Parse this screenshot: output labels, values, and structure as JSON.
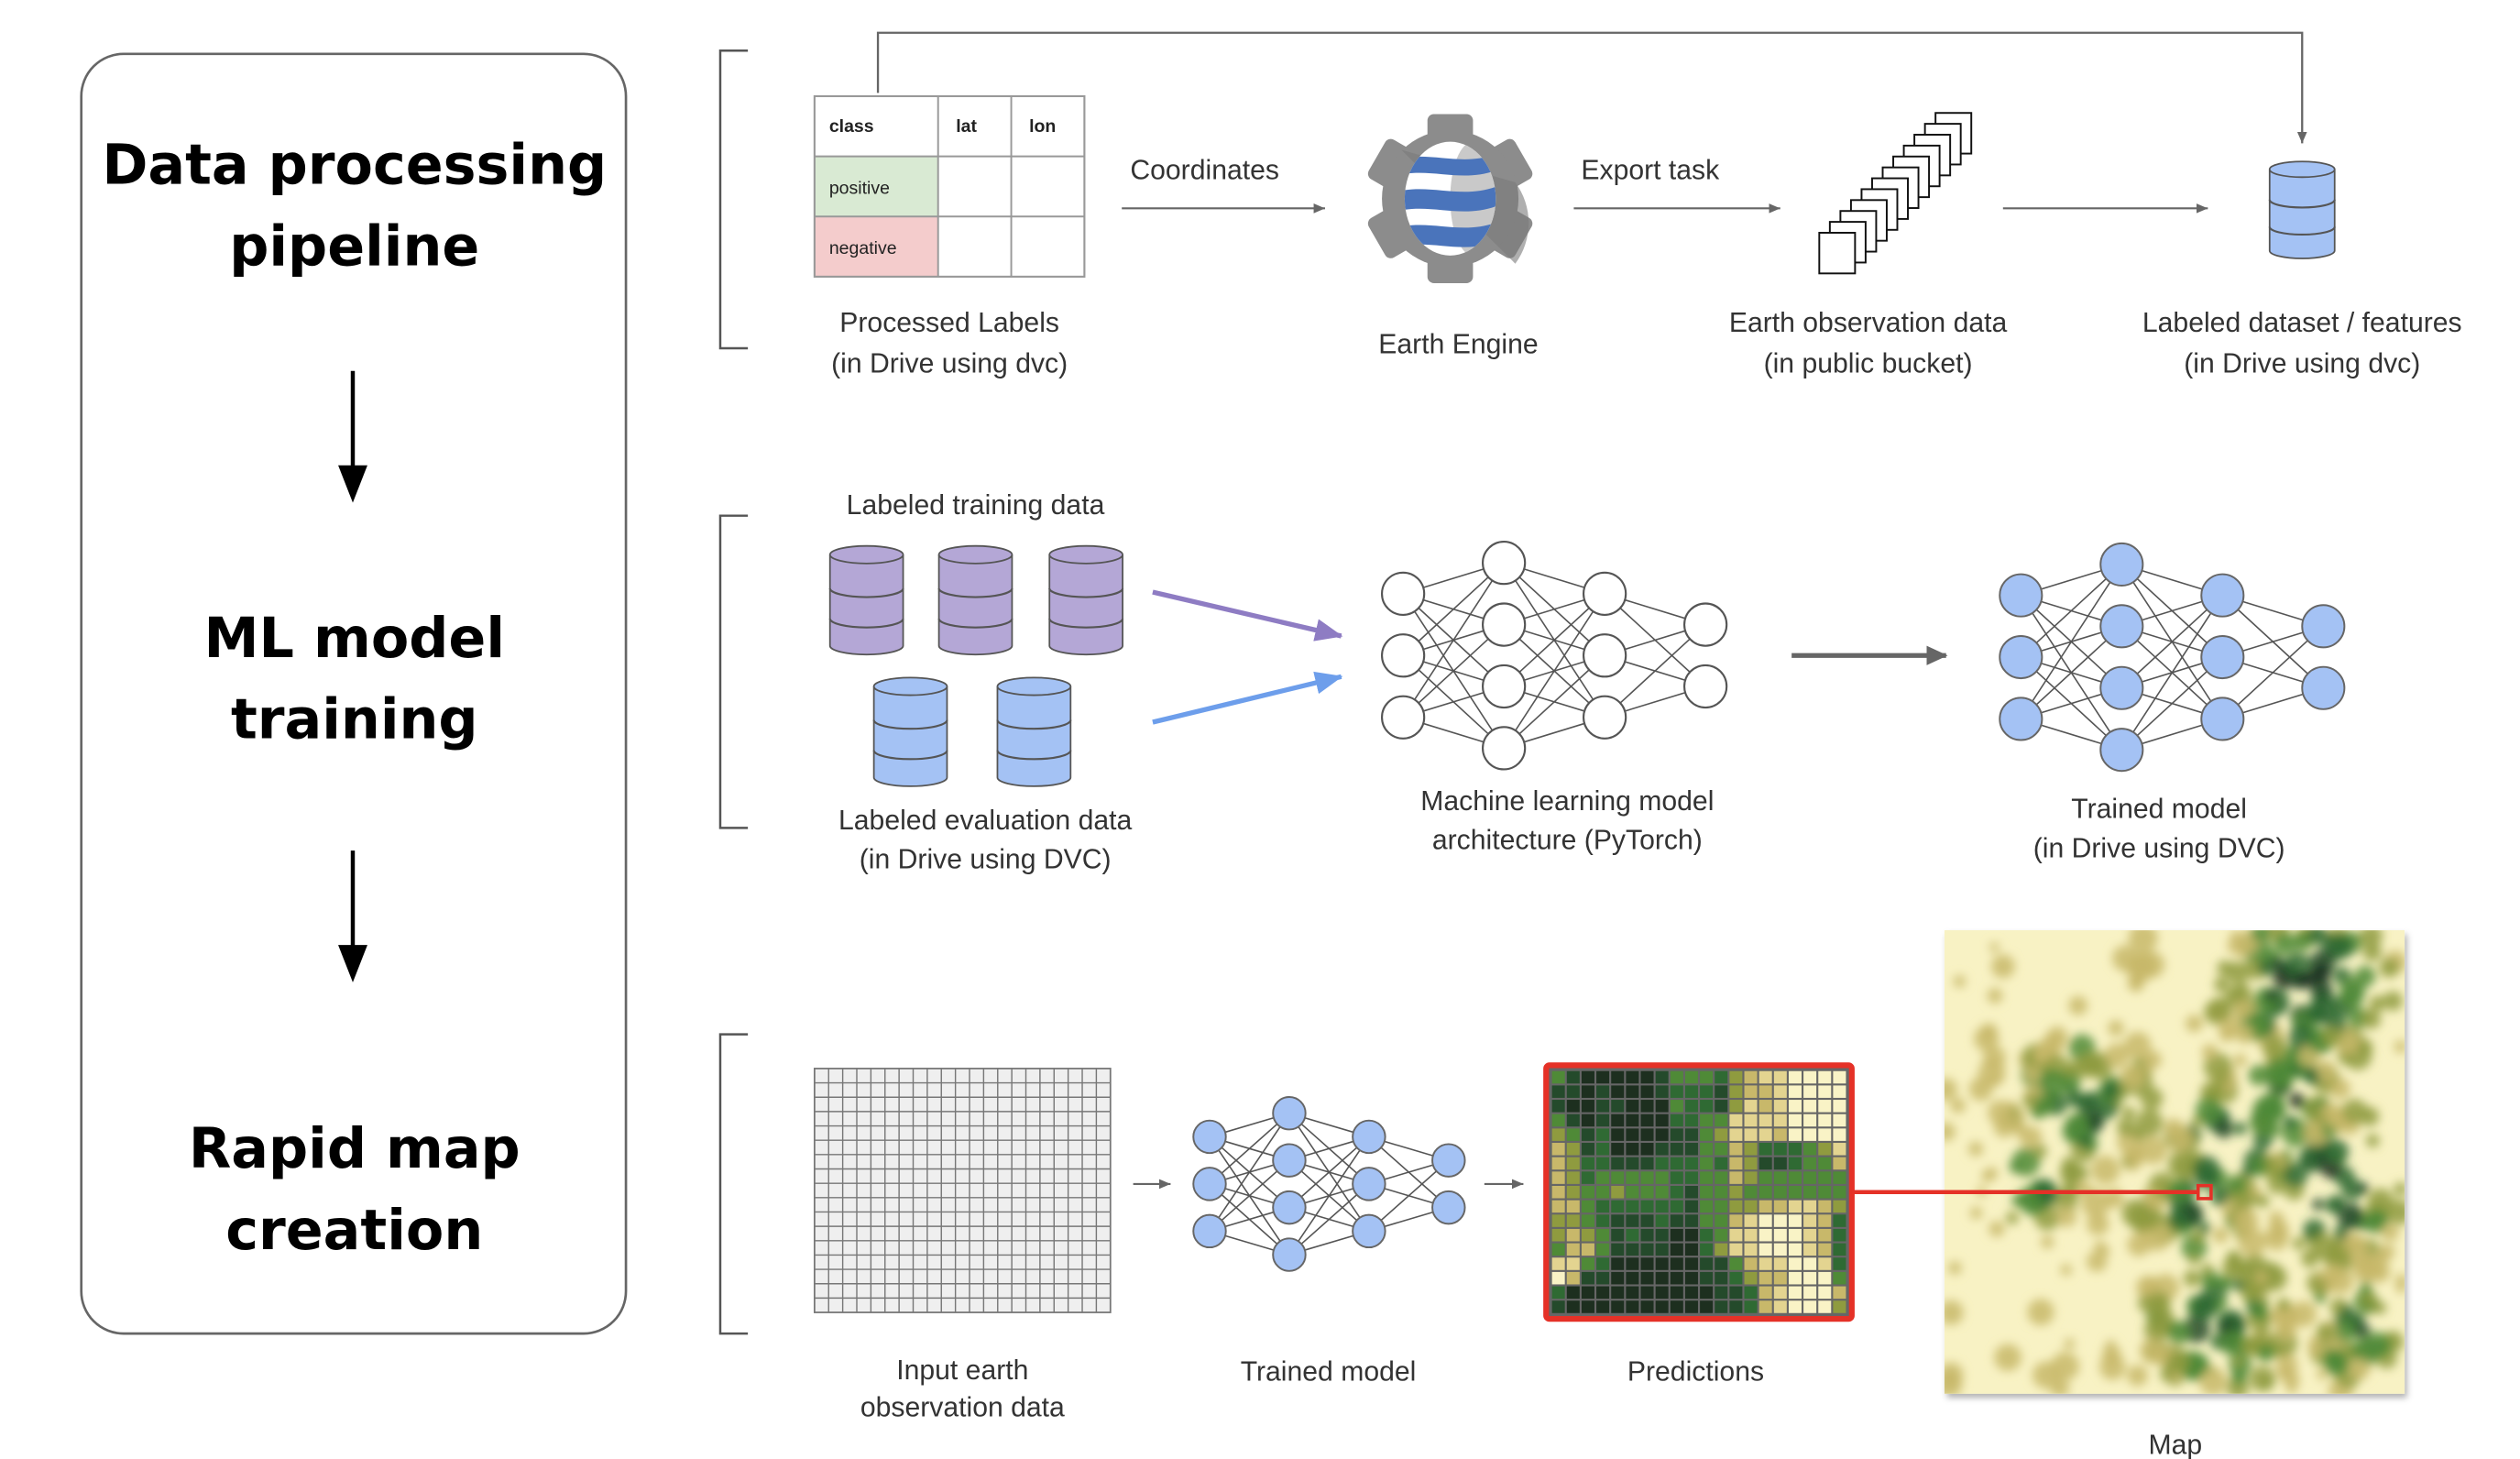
{
  "stages": [
    {
      "title_lines": [
        "Data processing",
        "pipeline"
      ]
    },
    {
      "title_lines": [
        "ML model",
        "training"
      ]
    },
    {
      "title_lines": [
        "Rapid map",
        "creation"
      ]
    }
  ],
  "row1": {
    "table": {
      "headers": [
        "class",
        "lat",
        "lon"
      ],
      "rows": [
        [
          "positive",
          "",
          ""
        ],
        [
          "negative",
          "",
          ""
        ]
      ],
      "positive_color": "#d9ead3",
      "negative_color": "#f4cccc"
    },
    "processed_labels": [
      "Processed Labels",
      "(in Drive using dvc)"
    ],
    "coordinates_label": "Coordinates",
    "earth_engine_label": "Earth Engine",
    "export_task_label": "Export task",
    "eo_data_label": [
      "Earth observation data",
      "(in public bucket)"
    ],
    "labeled_dataset_label": [
      "Labeled dataset / features",
      "(in Drive using dvc)"
    ]
  },
  "row2": {
    "training_data_label": "Labeled training data",
    "evaluation_data_label": [
      "Labeled evaluation data",
      "(in Drive using DVC)"
    ],
    "architecture_label": [
      "Machine learning model",
      "architecture (PyTorch)"
    ],
    "trained_model_label": [
      "Trained model",
      "(in Drive using DVC)"
    ],
    "training_color": "#b4a7d6",
    "evaluation_color": "#a4c2f4"
  },
  "row3": {
    "input_label": [
      "Input earth",
      "observation data"
    ],
    "trained_model_label": "Trained model",
    "predictions_label": "Predictions",
    "map_label": "Map",
    "highlight_color": "#e53127",
    "prediction_palette": [
      "#1d2f1f",
      "#244a2b",
      "#2f6a33",
      "#4f8a37",
      "#8f9b3f",
      "#c8b86a",
      "#e3d490",
      "#f9f3c6"
    ],
    "prediction_grid": [
      [
        3,
        1,
        0,
        0,
        0,
        0,
        0,
        1,
        3,
        3,
        3,
        2,
        4,
        5,
        6,
        6,
        7,
        7,
        7,
        7
      ],
      [
        1,
        1,
        0,
        1,
        0,
        0,
        0,
        1,
        2,
        2,
        2,
        1,
        4,
        5,
        5,
        6,
        7,
        7,
        7,
        7
      ],
      [
        1,
        0,
        0,
        1,
        1,
        0,
        0,
        0,
        3,
        2,
        2,
        1,
        4,
        6,
        5,
        6,
        7,
        7,
        7,
        7
      ],
      [
        3,
        1,
        0,
        1,
        0,
        0,
        0,
        0,
        2,
        2,
        3,
        3,
        6,
        6,
        6,
        6,
        7,
        7,
        7,
        7
      ],
      [
        4,
        3,
        1,
        2,
        0,
        0,
        0,
        0,
        1,
        1,
        3,
        4,
        6,
        6,
        6,
        5,
        7,
        7,
        7,
        7
      ],
      [
        5,
        4,
        1,
        2,
        0,
        0,
        0,
        1,
        1,
        1,
        3,
        3,
        5,
        4,
        2,
        2,
        2,
        3,
        4,
        6
      ],
      [
        5,
        4,
        2,
        2,
        1,
        1,
        1,
        2,
        2,
        2,
        3,
        2,
        5,
        4,
        1,
        1,
        2,
        3,
        3,
        5
      ],
      [
        5,
        4,
        2,
        3,
        3,
        3,
        3,
        3,
        2,
        2,
        3,
        3,
        5,
        4,
        3,
        3,
        3,
        3,
        3,
        3
      ],
      [
        5,
        4,
        3,
        3,
        4,
        3,
        3,
        3,
        2,
        1,
        3,
        3,
        4,
        3,
        3,
        3,
        3,
        3,
        3,
        3
      ],
      [
        5,
        5,
        3,
        2,
        2,
        2,
        2,
        2,
        2,
        1,
        3,
        3,
        4,
        4,
        5,
        5,
        6,
        6,
        5,
        4
      ],
      [
        4,
        4,
        3,
        2,
        1,
        1,
        1,
        2,
        1,
        1,
        3,
        3,
        5,
        6,
        7,
        7,
        7,
        6,
        5,
        2
      ],
      [
        4,
        5,
        4,
        3,
        1,
        2,
        1,
        1,
        0,
        0,
        2,
        3,
        6,
        6,
        7,
        7,
        7,
        6,
        5,
        2
      ],
      [
        3,
        5,
        5,
        3,
        1,
        1,
        1,
        1,
        0,
        0,
        2,
        4,
        6,
        6,
        7,
        7,
        7,
        6,
        5,
        2
      ],
      [
        6,
        6,
        3,
        2,
        0,
        0,
        0,
        0,
        0,
        0,
        1,
        1,
        3,
        5,
        6,
        6,
        7,
        7,
        6,
        2
      ],
      [
        7,
        5,
        1,
        1,
        0,
        0,
        0,
        0,
        0,
        0,
        1,
        1,
        2,
        4,
        5,
        5,
        7,
        7,
        7,
        3
      ],
      [
        2,
        0,
        0,
        0,
        0,
        0,
        0,
        0,
        0,
        0,
        0,
        1,
        1,
        2,
        5,
        6,
        7,
        7,
        7,
        5
      ],
      [
        1,
        0,
        0,
        0,
        0,
        0,
        0,
        0,
        0,
        0,
        0,
        1,
        1,
        2,
        5,
        6,
        7,
        7,
        7,
        4
      ]
    ]
  }
}
